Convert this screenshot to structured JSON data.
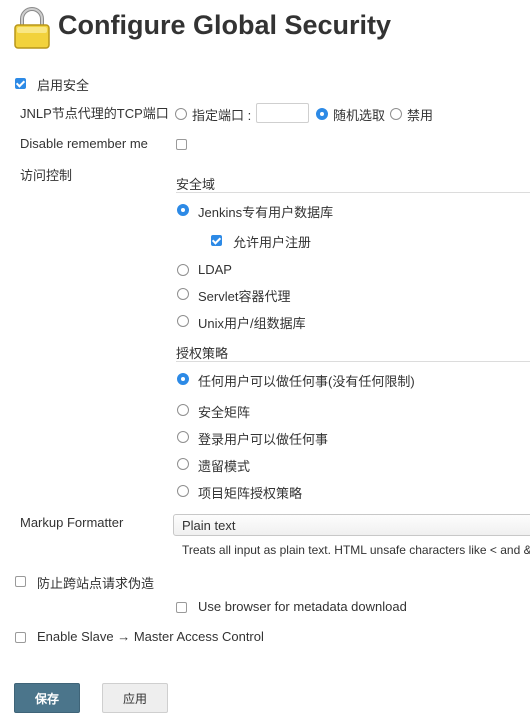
{
  "page": {
    "title": "Configure Global Security"
  },
  "enable_security": {
    "label": "启用安全",
    "checked": true
  },
  "jnlp": {
    "label": "JNLP节点代理的TCP端口",
    "option_fixed": "指定端口 :",
    "port_value": "",
    "option_random": "随机选取",
    "option_disable": "禁用",
    "selected": "随机选取"
  },
  "remember_me": {
    "label": "Disable remember me",
    "checked": false
  },
  "access_control": {
    "label": "访问控制",
    "security_realm": {
      "heading": "安全域",
      "options": [
        "Jenkins专有用户数据库",
        "LDAP",
        "Servlet容器代理",
        "Unix用户/组数据库"
      ],
      "selected": "Jenkins专有用户数据库",
      "allow_signup": {
        "label": "允许用户注册",
        "checked": true
      }
    },
    "authorization": {
      "heading": "授权策略",
      "options": [
        "任何用户可以做任何事(没有任何限制)",
        "安全矩阵",
        "登录用户可以做任何事",
        "遗留模式",
        "项目矩阵授权策略"
      ],
      "selected": "任何用户可以做任何事(没有任何限制)"
    }
  },
  "markup_formatter": {
    "label": "Markup Formatter",
    "selected": "Plain text",
    "description": "Treats all input as plain text. HTML unsafe characters like < and &"
  },
  "csrf": {
    "label": "防止跨站点请求伪造",
    "checked": false
  },
  "browser_metadata": {
    "label": "Use browser for metadata download",
    "checked": false
  },
  "slave_master": {
    "label": "Enable Slave → Master Access Control",
    "checked": false
  },
  "buttons": {
    "save": "保存",
    "apply": "应用"
  },
  "colors": {
    "primary_button": "#4b758b",
    "accent": "#2d8ae6",
    "lock": "#f2d23c"
  }
}
